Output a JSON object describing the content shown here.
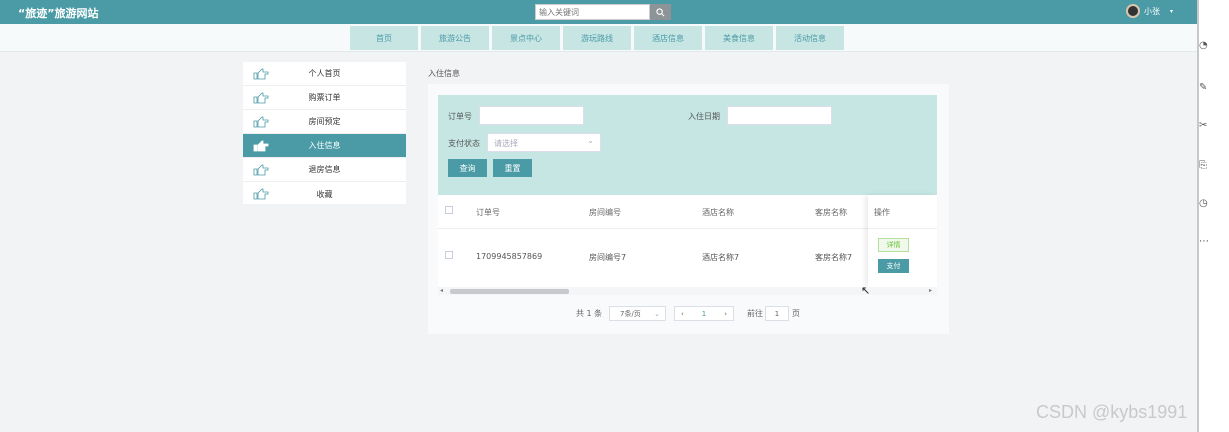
{
  "header": {
    "logo": "“旅迹”旅游网站",
    "search_placeholder": "输入关键词",
    "user_name": "小张",
    "caret": "▾",
    "bg_color": "#4a9ba6"
  },
  "nav": {
    "items": [
      {
        "label": "首页"
      },
      {
        "label": "旅游公告"
      },
      {
        "label": "景点中心"
      },
      {
        "label": "游玩路线"
      },
      {
        "label": "酒店信息"
      },
      {
        "label": "美食信息"
      },
      {
        "label": "活动信息"
      }
    ]
  },
  "sidebar": {
    "items": [
      {
        "label": "个人首页"
      },
      {
        "label": "购票订单"
      },
      {
        "label": "房间预定"
      },
      {
        "label": "入住信息",
        "active": true
      },
      {
        "label": "退房信息"
      },
      {
        "label": "收藏"
      }
    ],
    "icon": "pointing-hand-icon"
  },
  "breadcrumb": "入住信息",
  "filter": {
    "order_label": "订单号",
    "checkin_label": "入住日期",
    "pay_label": "支付状态",
    "pay_placeholder": "请选择",
    "query_button": "查询",
    "reset_button": "重置",
    "select_arrow": "⌄"
  },
  "table": {
    "headers": [
      "订单号",
      "房间编号",
      "酒店名称",
      "客房名称",
      "操作"
    ],
    "rows": [
      {
        "order": "1709945857869",
        "room_no": "房间编号7",
        "hotel": "酒店名称7",
        "room_name": "客房名称7",
        "detail": "详情",
        "pay": "支付"
      }
    ],
    "scroll_left": "◂",
    "scroll_right": "▸"
  },
  "pagination": {
    "total": "共 1 条",
    "page_size": "7条/页",
    "prev": "‹",
    "current": "1",
    "next": "›",
    "goto_label": "前往",
    "goto_value": "1",
    "page_unit": "页"
  },
  "watermark": "CSDN @kybs1991",
  "cursor": "↖"
}
